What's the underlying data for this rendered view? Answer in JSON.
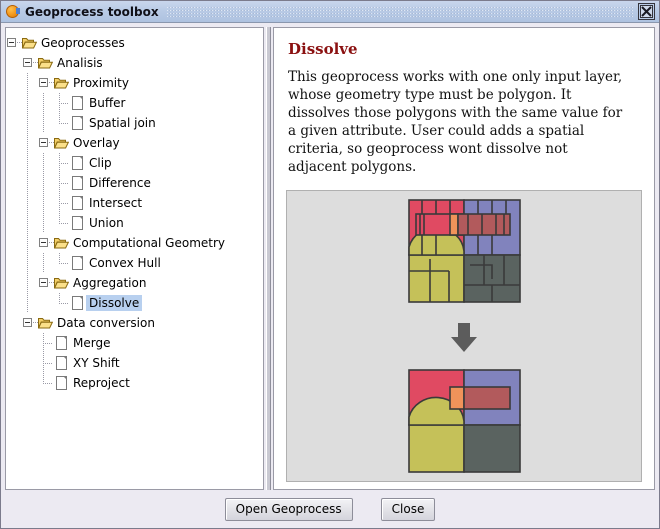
{
  "window": {
    "title": "Geoprocess toolbox",
    "icon": "app-globe-icon",
    "close_icon": "close-icon"
  },
  "tree": {
    "items": [
      {
        "label": "Geoprocesses",
        "depth": 0,
        "type": "folder",
        "expanded": true,
        "selected": false
      },
      {
        "label": "Analisis",
        "depth": 1,
        "type": "folder",
        "expanded": true,
        "selected": false
      },
      {
        "label": "Proximity",
        "depth": 2,
        "type": "folder",
        "expanded": true,
        "selected": false
      },
      {
        "label": "Buffer",
        "depth": 3,
        "type": "leaf",
        "expanded": false,
        "selected": false
      },
      {
        "label": "Spatial join",
        "depth": 3,
        "type": "leaf",
        "expanded": false,
        "selected": false,
        "last": true
      },
      {
        "label": "Overlay",
        "depth": 2,
        "type": "folder",
        "expanded": true,
        "selected": false
      },
      {
        "label": "Clip",
        "depth": 3,
        "type": "leaf",
        "expanded": false,
        "selected": false
      },
      {
        "label": "Difference",
        "depth": 3,
        "type": "leaf",
        "expanded": false,
        "selected": false
      },
      {
        "label": "Intersect",
        "depth": 3,
        "type": "leaf",
        "expanded": false,
        "selected": false
      },
      {
        "label": "Union",
        "depth": 3,
        "type": "leaf",
        "expanded": false,
        "selected": false,
        "last": true
      },
      {
        "label": "Computational Geometry",
        "depth": 2,
        "type": "folder",
        "expanded": true,
        "selected": false
      },
      {
        "label": "Convex Hull",
        "depth": 3,
        "type": "leaf",
        "expanded": false,
        "selected": false,
        "last": true
      },
      {
        "label": "Aggregation",
        "depth": 2,
        "type": "folder",
        "expanded": true,
        "selected": false,
        "last": true
      },
      {
        "label": "Dissolve",
        "depth": 3,
        "type": "leaf",
        "expanded": false,
        "selected": true,
        "last": true
      },
      {
        "label": "Data conversion",
        "depth": 1,
        "type": "folder",
        "expanded": true,
        "selected": false,
        "last": true
      },
      {
        "label": "Merge",
        "depth": 2,
        "type": "leaf",
        "expanded": false,
        "selected": false
      },
      {
        "label": "XY Shift",
        "depth": 2,
        "type": "leaf",
        "expanded": false,
        "selected": false
      },
      {
        "label": "Reproject",
        "depth": 2,
        "type": "leaf",
        "expanded": false,
        "selected": false,
        "last": true
      }
    ]
  },
  "detail": {
    "title": "Dissolve",
    "body": "This geoprocess works with one only input layer, whose geometry type must be polygon. It dissolves those polygons with the same value for a given attribute. User could adds a spatial criteria, so geoprocess wont dissolve not adjacent polygons.",
    "illustration_name": "dissolve-before-after-diagram",
    "arrow_icon": "down-arrow-icon"
  },
  "colors": {
    "polygon_red": "#e04a62",
    "polygon_purple": "#8183bd",
    "polygon_yellow": "#c5c159",
    "polygon_darkgray": "#5a6360",
    "polygon_orange": "#f0935a",
    "polygon_brick": "#b25a5c",
    "outline": "#3a3a3a",
    "illustration_bg": "#dddddd",
    "title_accent": "#8b1111",
    "selection": "#b8d0ef",
    "titlebar": "#b9cbe6"
  },
  "footer": {
    "open_label": "Open Geoprocess",
    "close_label": "Close"
  }
}
